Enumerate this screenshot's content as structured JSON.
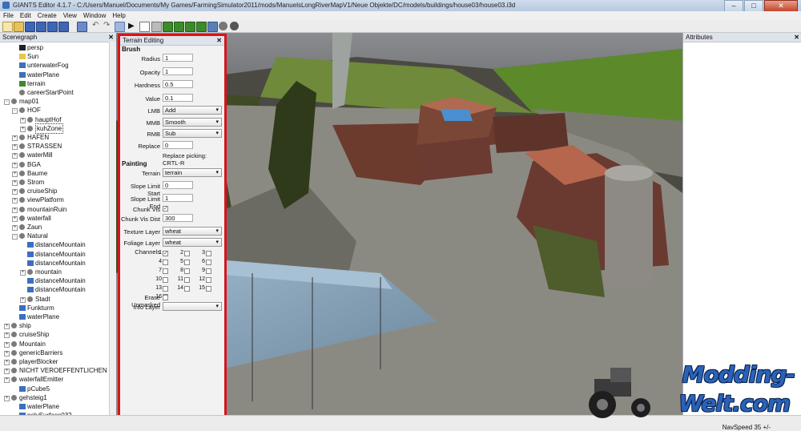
{
  "window": {
    "title": "GIANTS Editor 4.1.7 - C:/Users/Manuel/Documents/My Games/FarmingSimulator2011/mods/ManuelsLongRiverMapV1/Neue Objekte/DC/models/buildings/house03/house03.i3d"
  },
  "menu": [
    "File",
    "Edit",
    "Create",
    "View",
    "Window",
    "Help"
  ],
  "scenegraph": {
    "title": "Scenegraph",
    "nodes": [
      {
        "label": "persp",
        "depth": 1,
        "icon": "camera-icon",
        "toggle": ""
      },
      {
        "label": "Sun",
        "depth": 1,
        "icon": "light-icon",
        "toggle": ""
      },
      {
        "label": "unterwaterFog",
        "depth": 1,
        "icon": "shape-icon",
        "toggle": ""
      },
      {
        "label": "waterPlane",
        "depth": 1,
        "icon": "shape-icon",
        "toggle": ""
      },
      {
        "label": "terrain",
        "depth": 1,
        "icon": "terrain-icon",
        "toggle": ""
      },
      {
        "label": "careerStartPoint",
        "depth": 1,
        "icon": "transform-icon",
        "toggle": ""
      },
      {
        "label": "map01",
        "depth": 0,
        "icon": "transform-icon",
        "toggle": "-"
      },
      {
        "label": "HOF",
        "depth": 1,
        "icon": "transform-icon",
        "toggle": "-"
      },
      {
        "label": "hauptHof",
        "depth": 2,
        "icon": "transform-icon",
        "toggle": "+"
      },
      {
        "label": "kuhZone",
        "depth": 2,
        "icon": "transform-icon",
        "toggle": "+"
      },
      {
        "label": "HAFEN",
        "depth": 1,
        "icon": "transform-icon",
        "toggle": "+"
      },
      {
        "label": "STRASSEN",
        "depth": 1,
        "icon": "transform-icon",
        "toggle": "+"
      },
      {
        "label": "waterMill",
        "depth": 1,
        "icon": "transform-icon",
        "toggle": "+"
      },
      {
        "label": "BGA",
        "depth": 1,
        "icon": "transform-icon",
        "toggle": "+"
      },
      {
        "label": "Baume",
        "depth": 1,
        "icon": "transform-icon",
        "toggle": "+"
      },
      {
        "label": "Strom",
        "depth": 1,
        "icon": "transform-icon",
        "toggle": "+"
      },
      {
        "label": "cruiseShip",
        "depth": 1,
        "icon": "transform-icon",
        "toggle": "+"
      },
      {
        "label": "viewPlatform",
        "depth": 1,
        "icon": "transform-icon",
        "toggle": "+"
      },
      {
        "label": "mountainRuin",
        "depth": 1,
        "icon": "transform-icon",
        "toggle": "+"
      },
      {
        "label": "waterfall",
        "depth": 1,
        "icon": "transform-icon",
        "toggle": "+"
      },
      {
        "label": "Zaun",
        "depth": 1,
        "icon": "transform-icon",
        "toggle": "+"
      },
      {
        "label": "Natural",
        "depth": 1,
        "icon": "transform-icon",
        "toggle": "-"
      },
      {
        "label": "distanceMountain",
        "depth": 2,
        "icon": "shape-icon",
        "toggle": ""
      },
      {
        "label": "distanceMountain",
        "depth": 2,
        "icon": "shape-icon",
        "toggle": ""
      },
      {
        "label": "distanceMountain",
        "depth": 2,
        "icon": "shape-icon",
        "toggle": ""
      },
      {
        "label": "mountain",
        "depth": 2,
        "icon": "transform-icon",
        "toggle": "+"
      },
      {
        "label": "distanceMountain",
        "depth": 2,
        "icon": "shape-icon",
        "toggle": ""
      },
      {
        "label": "distanceMountain",
        "depth": 2,
        "icon": "shape-icon",
        "toggle": ""
      },
      {
        "label": "Stadt",
        "depth": 2,
        "icon": "transform-icon",
        "toggle": "+"
      },
      {
        "label": "Funkturm",
        "depth": 1,
        "icon": "shape-icon",
        "toggle": ""
      },
      {
        "label": "waterPlane",
        "depth": 1,
        "icon": "shape-icon",
        "toggle": ""
      },
      {
        "label": "ship",
        "depth": 0,
        "icon": "transform-icon",
        "toggle": "+"
      },
      {
        "label": "cruiseShip",
        "depth": 0,
        "icon": "transform-icon",
        "toggle": "+"
      },
      {
        "label": "Mountain",
        "depth": 0,
        "icon": "transform-icon",
        "toggle": "+"
      },
      {
        "label": "genericBarriers",
        "depth": 0,
        "icon": "transform-icon",
        "toggle": "+"
      },
      {
        "label": "playerBlocker",
        "depth": 0,
        "icon": "transform-icon",
        "toggle": "+"
      },
      {
        "label": "NICHT VEROEFFENTLICHEN",
        "depth": 0,
        "icon": "transform-icon",
        "toggle": "+"
      },
      {
        "label": "waterfallEmitter",
        "depth": 0,
        "icon": "transform-icon",
        "toggle": "+"
      },
      {
        "label": "pCube5",
        "depth": 1,
        "icon": "shape-icon",
        "toggle": ""
      },
      {
        "label": "gehsteig1",
        "depth": 0,
        "icon": "transform-icon",
        "toggle": "+"
      },
      {
        "label": "waterPlane",
        "depth": 1,
        "icon": "shape-icon",
        "toggle": ""
      },
      {
        "label": "polySurface032",
        "depth": 1,
        "icon": "shape-icon",
        "toggle": ""
      }
    ]
  },
  "terrain_editing": {
    "title": "Terrain Editing",
    "brush_header": "Brush",
    "radius": {
      "label": "Radius",
      "value": "1"
    },
    "opacity": {
      "label": "Opacity",
      "value": "1"
    },
    "hardness": {
      "label": "Hardness",
      "value": "0.5"
    },
    "value": {
      "label": "Value",
      "value": "0.1"
    },
    "lmb": {
      "label": "LMB",
      "value": "Add"
    },
    "mmb": {
      "label": "MMB",
      "value": "Smooth"
    },
    "rmb": {
      "label": "RMB",
      "value": "Sub"
    },
    "replace": {
      "label": "Replace",
      "value": "0"
    },
    "replace_hint": "Replace picking: CRTL-R",
    "painting_header": "Painting",
    "terrain": {
      "label": "Terrain",
      "value": "terrain"
    },
    "slope_start": {
      "label": "Slope Limit Start",
      "value": "0"
    },
    "slope_end": {
      "label": "Slope Limit End",
      "value": "1"
    },
    "chunk_vis": {
      "label": "Chunk Vis",
      "checked": true
    },
    "chunk_vis_dist": {
      "label": "Chunk Vis Dist",
      "value": "300"
    },
    "texture_layer": {
      "label": "Texture Layer",
      "value": "wheat"
    },
    "foliage_layer": {
      "label": "Foliage Layer",
      "value": "wheat"
    },
    "channels_label": "Channels",
    "channels": [
      "1",
      "2",
      "3",
      "4",
      "5",
      "6",
      "7",
      "8",
      "9",
      "10",
      "11",
      "12",
      "13",
      "14",
      "15",
      "16"
    ],
    "channels_checked": [
      "1"
    ],
    "erase_unmasked": {
      "label": "Erase Unmasked",
      "checked": true
    },
    "info_layer": {
      "label": "Info Layer",
      "value": ""
    },
    "close": "✕"
  },
  "attributes": {
    "title": "Attributes",
    "close": "✕"
  },
  "status": {
    "navspeed": "NavSpeed 35 +/-"
  },
  "watermark": {
    "line1": "Modding-",
    "line2": "Welt.com"
  },
  "colors": {
    "highlight": "#d8141c",
    "watermark": "#2a62b8"
  }
}
